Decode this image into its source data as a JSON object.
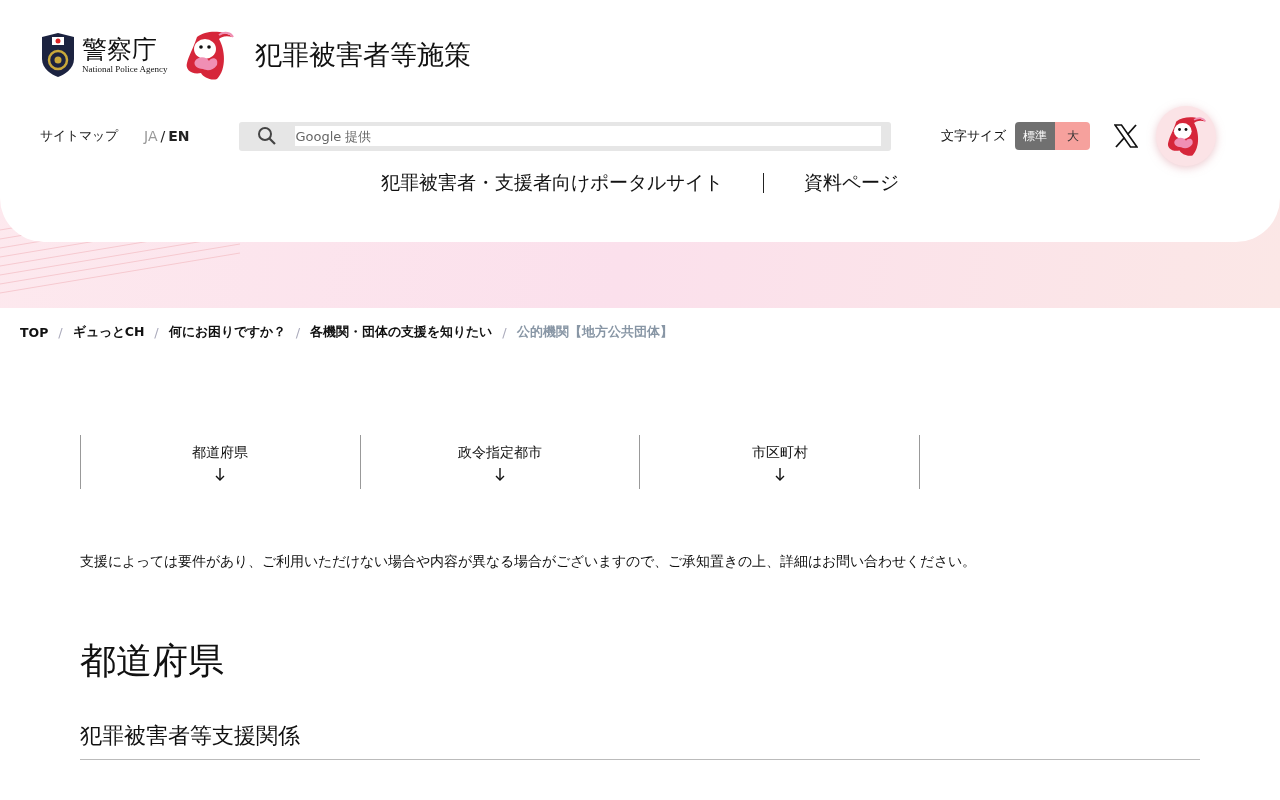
{
  "header": {
    "agency_name": "警察庁",
    "agency_name_en": "National Police Agency",
    "site_title": "犯罪被害者等施策",
    "utility_links": [
      {
        "label": "サイトマップ"
      }
    ],
    "languages": [
      {
        "label": "JA",
        "selected": false
      },
      {
        "label": "EN",
        "selected": true
      }
    ],
    "language_separator": "/",
    "search": {
      "placeholder": "Google 提供"
    },
    "font_size": {
      "label": "文字サイズ",
      "options": [
        {
          "label": "標準",
          "selected": true
        },
        {
          "label": "大",
          "selected": false
        }
      ]
    },
    "nav": [
      {
        "label": "犯罪被害者・支援者向けポータルサイト"
      },
      {
        "label": "資料ページ"
      }
    ]
  },
  "breadcrumb": [
    {
      "label": "TOP",
      "current": false
    },
    {
      "label": "ギュっとCH",
      "current": false
    },
    {
      "label": "何にお困りですか？",
      "current": false
    },
    {
      "label": "各機関・団体の支援を知りたい",
      "current": false
    },
    {
      "label": "公的機関【地方公共団体】",
      "current": true
    }
  ],
  "breadcrumb_separator": "/",
  "anchor_tabs": [
    {
      "label": "都道府県"
    },
    {
      "label": "政令指定都市"
    },
    {
      "label": "市区町村"
    }
  ],
  "notice": "支援によっては要件があり、ご利用いただけない場合や内容が異なる場合がございますので、ご承知置きの上、詳細はお問い合わせください。",
  "section_heading": "都道府県",
  "subsection_heading": "犯罪被害者等支援関係"
}
